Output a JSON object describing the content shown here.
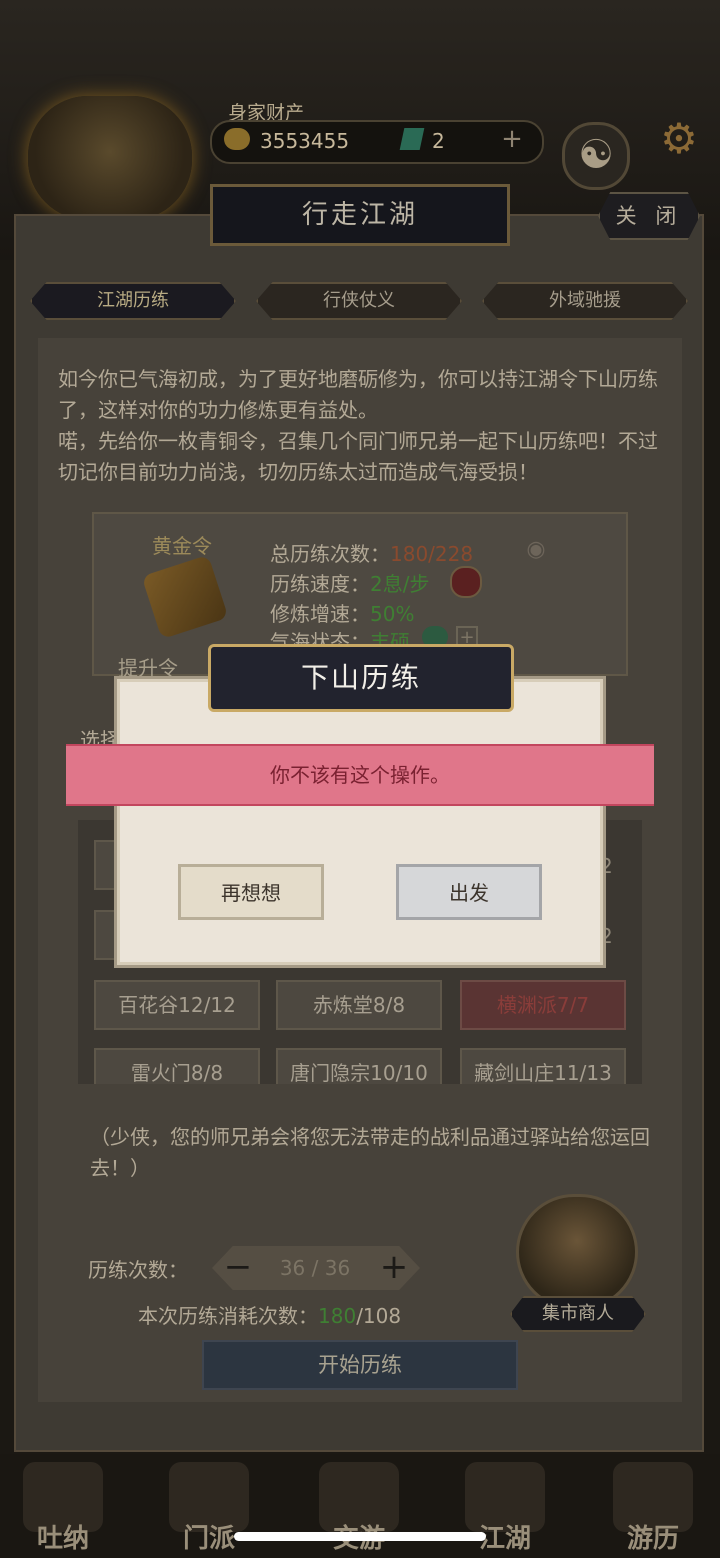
{
  "header": {
    "assets_label": "身家财产",
    "coins": "3553455",
    "gems": "2",
    "plus": "+"
  },
  "window": {
    "title": "行走江湖",
    "close_label": "关 闭"
  },
  "tabs": [
    {
      "label": "江湖历练",
      "active": true
    },
    {
      "label": "行侠仗义",
      "active": false
    },
    {
      "label": "外域驰援",
      "active": false
    }
  ],
  "intro_text": "如今你已气海初成，为了更好地磨砺修为，你可以持江湖令下山历练了，这样对你的功力修炼更有益处。",
  "intro_text2": "喏，先给你一枚青铜令，召集几个同门师兄弟一起下山历练吧！不过切记你目前功力尚浅，切勿历练太过而造成气海受损！",
  "token": {
    "name": "黄金令",
    "stats": [
      {
        "label": "总历练次数：",
        "value": "180/228",
        "color": "red"
      },
      {
        "label": "历练速度：",
        "value": "2息/步",
        "color": "green"
      },
      {
        "label": "修炼增速：",
        "value": "50%",
        "color": "green"
      },
      {
        "label": "气海状态：",
        "value": "丰硕",
        "color": "green"
      }
    ],
    "upgrade_label": "提升令"
  },
  "choose_label": "选择",
  "sects": [
    {
      "label": "百花谷12/12",
      "highlight": false
    },
    {
      "label": "赤炼堂8/8",
      "highlight": false
    },
    {
      "label": "横渊派7/7",
      "highlight": true
    },
    {
      "label": "雷火门8/8",
      "highlight": false
    },
    {
      "label": "唐门隐宗10/10",
      "highlight": false
    },
    {
      "label": "藏剑山庄11/13",
      "highlight": false
    }
  ],
  "partial_digit": "2",
  "note": "（少侠，您的师兄弟会将您无法带走的战利品通过驿站给您运回去！）",
  "count": {
    "label": "历练次数：",
    "value": "36 / 36",
    "minus": "−",
    "plus": "+"
  },
  "consume": {
    "label": "本次历练消耗次数：",
    "used": "180",
    "total": "/108"
  },
  "start_button": "开始历练",
  "merchant_label": "集市商人",
  "bottom_nav": [
    "吐纳",
    "门派",
    "交游",
    "江湖",
    "游历"
  ],
  "modal": {
    "title": "下山历练",
    "toast": "你不该有这个操作。",
    "cancel_label": "再想想",
    "confirm_label": "出发"
  },
  "colors": {
    "accent_red": "#8a4a2e",
    "accent_green": "#3f7f33",
    "toast_bg": "#e0768a",
    "modal_title_border": "#c9a965"
  }
}
